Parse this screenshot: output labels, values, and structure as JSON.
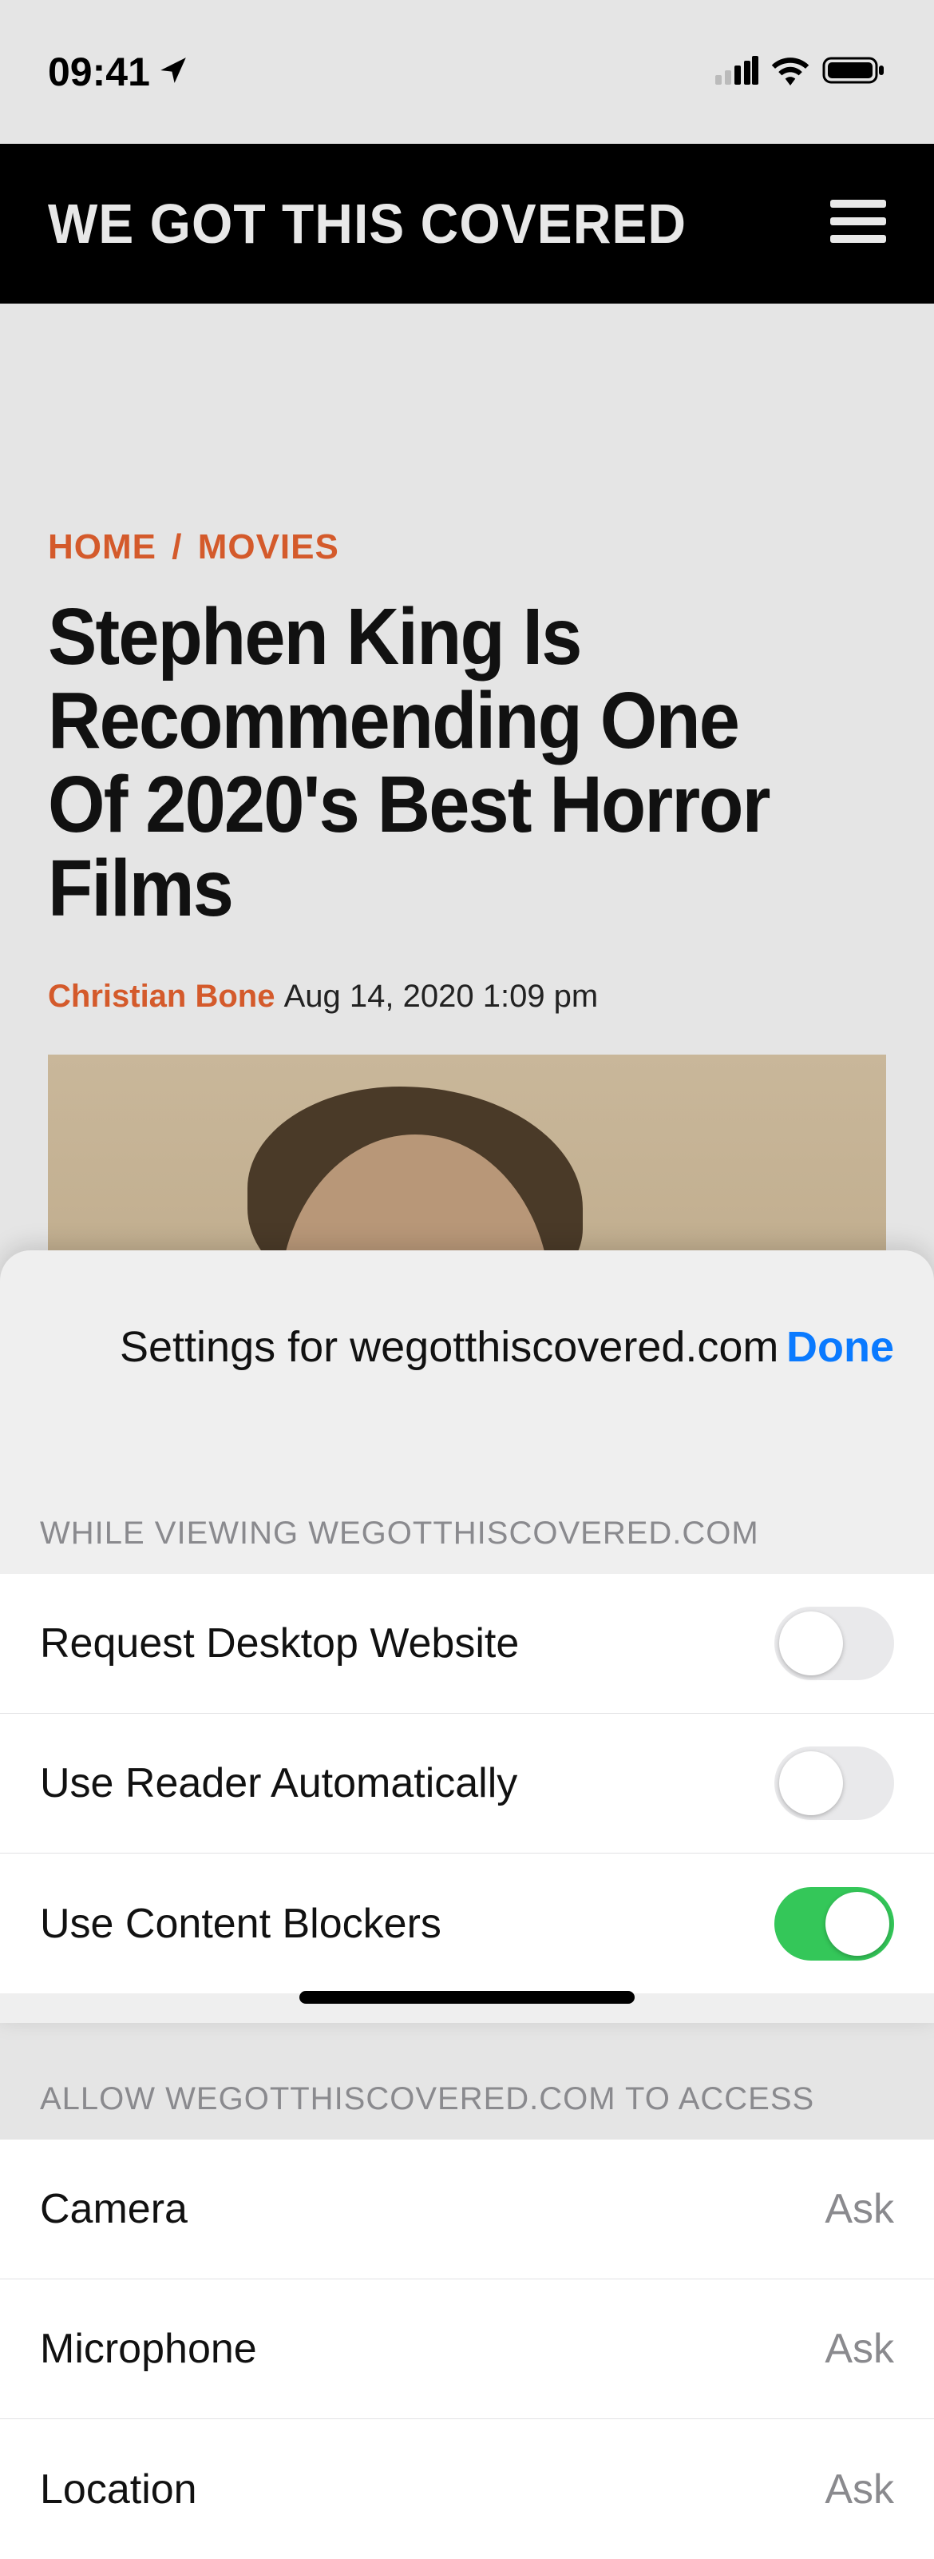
{
  "status": {
    "time": "09:41"
  },
  "site": {
    "logo": "WE GOT THIS COVERED"
  },
  "article": {
    "breadcrumb_home": "HOME",
    "breadcrumb_cat": "MOVIES",
    "title": "Stephen King Is Recommending One Of 2020's Best Horror Films",
    "author": "Christian Bone",
    "date": "Aug 14, 2020 1:09 pm"
  },
  "sheet": {
    "title": "Settings for wegotthiscovered.com",
    "done": "Done",
    "section1": "WHILE VIEWING WEGOTTHISCOVERED.COM",
    "section2": "ALLOW WEGOTTHISCOVERED.COM TO ACCESS",
    "rows": {
      "desktop": {
        "label": "Request Desktop Website",
        "on": false
      },
      "reader": {
        "label": "Use Reader Automatically",
        "on": false
      },
      "blockers": {
        "label": "Use Content Blockers",
        "on": true
      },
      "camera": {
        "label": "Camera",
        "value": "Ask"
      },
      "microphone": {
        "label": "Microphone",
        "value": "Ask"
      },
      "location": {
        "label": "Location",
        "value": "Ask"
      }
    }
  }
}
